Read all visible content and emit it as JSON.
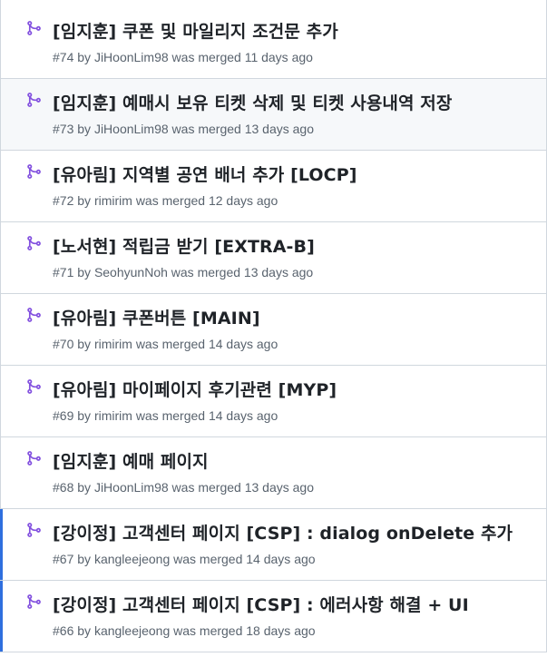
{
  "pull_requests": [
    {
      "title": "[임지훈] 쿠폰 및 마일리지 조건문 추가",
      "number": "#74",
      "by": "by",
      "author": "JiHoonLim98",
      "status": "was merged 11 days ago"
    },
    {
      "title": "[임지훈] 예매시 보유 티켓 삭제 및 티켓 사용내역 저장",
      "number": "#73",
      "by": "by",
      "author": "JiHoonLim98",
      "status": "was merged 13 days ago"
    },
    {
      "title": "[유아림] 지역별 공연 배너 추가 [LOCP]",
      "number": "#72",
      "by": "by",
      "author": "rimirim",
      "status": "was merged 12 days ago"
    },
    {
      "title": "[노서현] 적립금 받기 [EXTRA-B]",
      "number": "#71",
      "by": "by",
      "author": "SeohyunNoh",
      "status": "was merged 13 days ago"
    },
    {
      "title": "[유아림] 쿠폰버튼 [MAIN]",
      "number": "#70",
      "by": "by",
      "author": "rimirim",
      "status": "was merged 14 days ago"
    },
    {
      "title": "[유아림] 마이페이지 후기관련 [MYP]",
      "number": "#69",
      "by": "by",
      "author": "rimirim",
      "status": "was merged 14 days ago"
    },
    {
      "title": "[임지훈] 예매 페이지",
      "number": "#68",
      "by": "by",
      "author": "JiHoonLim98",
      "status": "was merged 13 days ago"
    },
    {
      "title": "[강이정] 고객센터 페이지 [CSP] : dialog onDelete 추가",
      "number": "#67",
      "by": "by",
      "author": "kangleejeong",
      "status": "was merged 14 days ago"
    },
    {
      "title": "[강이정] 고객센터 페이지 [CSP] : 에러사항 해결 + UI",
      "number": "#66",
      "by": "by",
      "author": "kangleejeong",
      "status": "was merged 18 days ago"
    }
  ],
  "colors": {
    "merged_icon": "#8250df",
    "title": "#1f2328",
    "meta": "#59636e",
    "border": "#d0d7de",
    "hover_bg": "#f6f8fa",
    "selected_accent": "#2f6fde"
  },
  "icons": {
    "pr_state": "git-merge-icon"
  }
}
